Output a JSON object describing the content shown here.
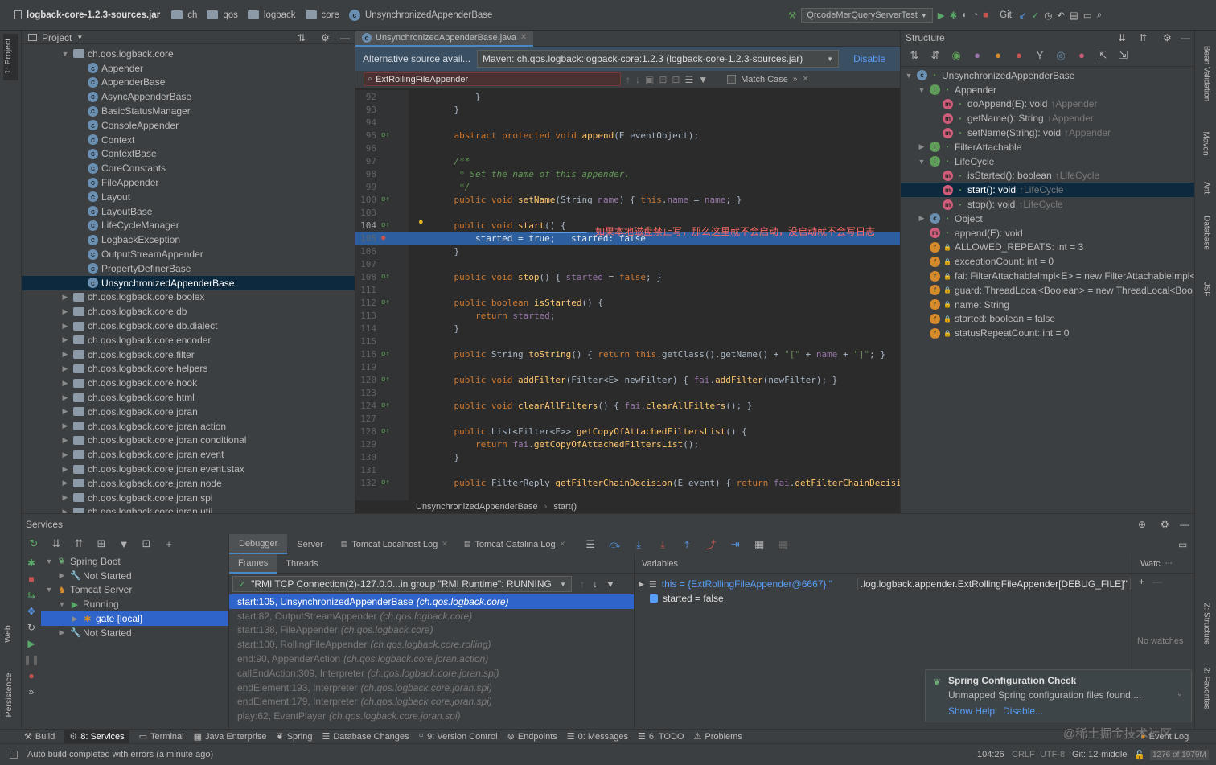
{
  "colors": {
    "bg": "#2b2b2b",
    "panel": "#3c3f41",
    "selection": "#2f65ca",
    "accent": "#589df6",
    "keyword": "#cc7832",
    "method": "#ffc66d",
    "field": "#9876aa",
    "string": "#6a8759",
    "comment": "#808080",
    "red_text": "#ff6b68"
  },
  "title_bar": {
    "project": "logback-core-1.2.3-sources.jar",
    "crumbs": [
      "ch",
      "qos",
      "logback",
      "core"
    ],
    "current": "UnsynchronizedAppenderBase",
    "run_config": "QrcodeMerQueryServerTest",
    "git_label": "Git:"
  },
  "left_strip": {
    "project_tab": "1: Project",
    "web_tab": "Web",
    "persistence_tab": "Persistence"
  },
  "right_strip": {
    "bean_validation": "Bean Validation",
    "maven": "Maven",
    "ant": "Ant",
    "database": "Database",
    "jsf": "JSF",
    "structure": "Z: Structure",
    "favorites": "2: Favorites"
  },
  "project_panel": {
    "title": "Project",
    "items": [
      {
        "label": "ch.qos.logback.core",
        "kind": "package",
        "depth": 0,
        "expanded": true
      },
      {
        "label": "Appender",
        "kind": "class",
        "depth": 1
      },
      {
        "label": "AppenderBase",
        "kind": "class",
        "depth": 1
      },
      {
        "label": "AsyncAppenderBase",
        "kind": "class",
        "depth": 1
      },
      {
        "label": "BasicStatusManager",
        "kind": "class",
        "depth": 1
      },
      {
        "label": "ConsoleAppender",
        "kind": "class",
        "depth": 1
      },
      {
        "label": "Context",
        "kind": "class",
        "depth": 1
      },
      {
        "label": "ContextBase",
        "kind": "class",
        "depth": 1
      },
      {
        "label": "CoreConstants",
        "kind": "class",
        "depth": 1
      },
      {
        "label": "FileAppender",
        "kind": "class",
        "depth": 1
      },
      {
        "label": "Layout",
        "kind": "class",
        "depth": 1
      },
      {
        "label": "LayoutBase",
        "kind": "class",
        "depth": 1
      },
      {
        "label": "LifeCycleManager",
        "kind": "class",
        "depth": 1
      },
      {
        "label": "LogbackException",
        "kind": "class",
        "depth": 1
      },
      {
        "label": "OutputStreamAppender",
        "kind": "class",
        "depth": 1
      },
      {
        "label": "PropertyDefinerBase",
        "kind": "class",
        "depth": 1
      },
      {
        "label": "UnsynchronizedAppenderBase",
        "kind": "class",
        "depth": 1,
        "selected": true
      },
      {
        "label": "ch.qos.logback.core.boolex",
        "kind": "package",
        "depth": 0
      },
      {
        "label": "ch.qos.logback.core.db",
        "kind": "package",
        "depth": 0
      },
      {
        "label": "ch.qos.logback.core.db.dialect",
        "kind": "package",
        "depth": 0
      },
      {
        "label": "ch.qos.logback.core.encoder",
        "kind": "package",
        "depth": 0
      },
      {
        "label": "ch.qos.logback.core.filter",
        "kind": "package",
        "depth": 0
      },
      {
        "label": "ch.qos.logback.core.helpers",
        "kind": "package",
        "depth": 0
      },
      {
        "label": "ch.qos.logback.core.hook",
        "kind": "package",
        "depth": 0
      },
      {
        "label": "ch.qos.logback.core.html",
        "kind": "package",
        "depth": 0
      },
      {
        "label": "ch.qos.logback.core.joran",
        "kind": "package",
        "depth": 0
      },
      {
        "label": "ch.qos.logback.core.joran.action",
        "kind": "package",
        "depth": 0
      },
      {
        "label": "ch.qos.logback.core.joran.conditional",
        "kind": "package",
        "depth": 0
      },
      {
        "label": "ch.qos.logback.core.joran.event",
        "kind": "package",
        "depth": 0
      },
      {
        "label": "ch.qos.logback.core.joran.event.stax",
        "kind": "package",
        "depth": 0
      },
      {
        "label": "ch.qos.logback.core.joran.node",
        "kind": "package",
        "depth": 0
      },
      {
        "label": "ch.qos.logback.core.joran.spi",
        "kind": "package",
        "depth": 0
      },
      {
        "label": "ch.qos.logback.core.joran.util",
        "kind": "package",
        "depth": 0
      }
    ]
  },
  "editor": {
    "tab": "UnsynchronizedAppenderBase.java",
    "banner": {
      "text": "Alternative source avail...",
      "selected_source": "Maven: ch.qos.logback:logback-core:1.2.3 (logback-core-1.2.3-sources.jar)",
      "disable_label": "Disable"
    },
    "search": {
      "value": "ExtRollingFileAppender",
      "match_case_label": "Match Case"
    },
    "annotation": "如果本地磁盘禁止写，那么这里就不会启动，没启动就不会写日志",
    "lines": [
      {
        "n": "92",
        "t": "        }"
      },
      {
        "n": "93",
        "t": "    }"
      },
      {
        "n": "94",
        "t": ""
      },
      {
        "n": "95",
        "t": "    abstract protected void append(E eventObject);"
      },
      {
        "n": "96",
        "t": ""
      },
      {
        "n": "97",
        "t": "    /**",
        "c": "comment"
      },
      {
        "n": "98",
        "t": "     * Set the name of this appender.",
        "c": "comment"
      },
      {
        "n": "99",
        "t": "     */",
        "c": "comment"
      },
      {
        "n": "100",
        "t": "    public void setName(String name) { this.name = name; }"
      },
      {
        "n": "103",
        "t": ""
      },
      {
        "n": "104",
        "t": "    public void start() {"
      },
      {
        "n": "105",
        "t": "        started = true;   started: false",
        "c": "exec"
      },
      {
        "n": "106",
        "t": "    }"
      },
      {
        "n": "107",
        "t": ""
      },
      {
        "n": "108",
        "t": "    public void stop() { started = false; }"
      },
      {
        "n": "111",
        "t": ""
      },
      {
        "n": "112",
        "t": "    public boolean isStarted() {"
      },
      {
        "n": "113",
        "t": "        return started;"
      },
      {
        "n": "114",
        "t": "    }"
      },
      {
        "n": "115",
        "t": ""
      },
      {
        "n": "116",
        "t": "    public String toString() { return this.getClass().getName() + \"[\" + name + \"]\"; }"
      },
      {
        "n": "119",
        "t": ""
      },
      {
        "n": "120",
        "t": "    public void addFilter(Filter<E> newFilter) { fai.addFilter(newFilter); }"
      },
      {
        "n": "123",
        "t": ""
      },
      {
        "n": "124",
        "t": "    public void clearAllFilters() { fai.clearAllFilters(); }"
      },
      {
        "n": "127",
        "t": ""
      },
      {
        "n": "128",
        "t": "    public List<Filter<E>> getCopyOfAttachedFiltersList() {"
      },
      {
        "n": "129",
        "t": "        return fai.getCopyOfAttachedFiltersList();"
      },
      {
        "n": "130",
        "t": "    }"
      },
      {
        "n": "131",
        "t": ""
      },
      {
        "n": "132",
        "t": "    public FilterReply getFilterChainDecision(E event) { return fai.getFilterChainDecision(event)"
      }
    ],
    "breadcrumb": [
      "UnsynchronizedAppenderBase",
      "start()"
    ]
  },
  "structure": {
    "title": "Structure",
    "items": [
      {
        "label": "UnsynchronizedAppenderBase",
        "icon": "c",
        "depth": 0,
        "arrow": "▼"
      },
      {
        "label": "Appender",
        "icon": "i",
        "depth": 1,
        "arrow": "▼"
      },
      {
        "label": "doAppend(E): void",
        "suffix": "↑Appender",
        "icon": "m",
        "depth": 2
      },
      {
        "label": "getName(): String",
        "suffix": "↑Appender",
        "icon": "m",
        "depth": 2
      },
      {
        "label": "setName(String): void",
        "suffix": "↑Appender",
        "icon": "m",
        "depth": 2
      },
      {
        "label": "FilterAttachable",
        "icon": "i",
        "depth": 1,
        "arrow": "▶"
      },
      {
        "label": "LifeCycle",
        "icon": "i",
        "depth": 1,
        "arrow": "▼"
      },
      {
        "label": "isStarted(): boolean",
        "suffix": "↑LifeCycle",
        "icon": "m",
        "depth": 2
      },
      {
        "label": "start(): void",
        "suffix": "↑LifeCycle",
        "icon": "m",
        "depth": 2,
        "selected": true
      },
      {
        "label": "stop(): void",
        "suffix": "↑LifeCycle",
        "icon": "m",
        "depth": 2
      },
      {
        "label": "Object",
        "icon": "c",
        "depth": 1,
        "arrow": "▶"
      },
      {
        "label": "append(E): void",
        "icon": "m",
        "depth": 1
      },
      {
        "label": "ALLOWED_REPEATS: int = 3",
        "icon": "f",
        "depth": 1
      },
      {
        "label": "exceptionCount: int = 0",
        "icon": "f",
        "depth": 1
      },
      {
        "label": "fai: FilterAttachableImpl<E> = new FilterAttachableImpl<",
        "icon": "f",
        "depth": 1
      },
      {
        "label": "guard: ThreadLocal<Boolean> = new ThreadLocal<Boo",
        "icon": "f",
        "depth": 1
      },
      {
        "label": "name: String",
        "icon": "f",
        "depth": 1
      },
      {
        "label": "started: boolean = false",
        "icon": "f",
        "depth": 1
      },
      {
        "label": "statusRepeatCount: int = 0",
        "icon": "f",
        "depth": 1
      }
    ]
  },
  "services": {
    "title": "Services",
    "tree": [
      {
        "label": "Spring Boot",
        "depth": 0,
        "arrow": "▼"
      },
      {
        "label": "Not Started",
        "depth": 1,
        "arrow": "▶"
      },
      {
        "label": "Tomcat Server",
        "depth": 0,
        "arrow": "▼"
      },
      {
        "label": "Running",
        "depth": 1,
        "arrow": "▼"
      },
      {
        "label": "gate [local]",
        "depth": 2,
        "arrow": "▶",
        "selected": true
      },
      {
        "label": "Not Started",
        "depth": 1,
        "arrow": "▶"
      }
    ],
    "tabs": [
      "Debugger",
      "Server",
      "Tomcat Localhost Log",
      "Tomcat Catalina Log"
    ],
    "frames_tab": "Frames",
    "threads_tab": "Threads",
    "thread_select": "\"RMI TCP Connection(2)-127.0.0...in group \"RMI Runtime\": RUNNING",
    "frames": [
      {
        "m": "start:105, UnsynchronizedAppenderBase",
        "p": "(ch.qos.logback.core)",
        "selected": true
      },
      {
        "m": "start:82, OutputStreamAppender",
        "p": "(ch.qos.logback.core)"
      },
      {
        "m": "start:138, FileAppender",
        "p": "(ch.qos.logback.core)"
      },
      {
        "m": "start:100, RollingFileAppender",
        "p": "(ch.qos.logback.core.rolling)"
      },
      {
        "m": "end:90, AppenderAction",
        "p": "(ch.qos.logback.core.joran.action)"
      },
      {
        "m": "callEndAction:309, Interpreter",
        "p": "(ch.qos.logback.core.joran.spi)"
      },
      {
        "m": "endElement:193, Interpreter",
        "p": "(ch.qos.logback.core.joran.spi)"
      },
      {
        "m": "endElement:179, Interpreter",
        "p": "(ch.qos.logback.core.joran.spi)"
      },
      {
        "m": "play:62, EventPlayer",
        "p": "(ch.qos.logback.core.joran.spi)"
      }
    ],
    "variables_title": "Variables",
    "var_this": "this = {ExtRollingFileAppender@6667} \"",
    "var_this_tail": ".log.logback.appender.ExtRollingFileAppender[DEBUG_FILE]\"",
    "var_started": "started = false",
    "watches_title": "Watc",
    "no_watches": "No watches"
  },
  "notification": {
    "title": "Spring Configuration Check",
    "body": "Unmapped Spring configuration files found....",
    "show_help": "Show Help",
    "disable": "Disable..."
  },
  "bottom_tabs": [
    "Build",
    "8: Services",
    "Terminal",
    "Java Enterprise",
    "Spring",
    "Database Changes",
    "9: Version Control",
    "Endpoints",
    "0: Messages",
    "6: TODO",
    "Problems",
    "Event Log"
  ],
  "status_bar": {
    "message": "Auto build completed with errors (a minute ago)",
    "position": "104:26",
    "line_sep": "CRLF",
    "encoding": "UTF-8",
    "git_branch": "Git: 12-middle",
    "memory": "1276 of 1979M",
    "watermark": "@稀土掘金技术社区"
  }
}
